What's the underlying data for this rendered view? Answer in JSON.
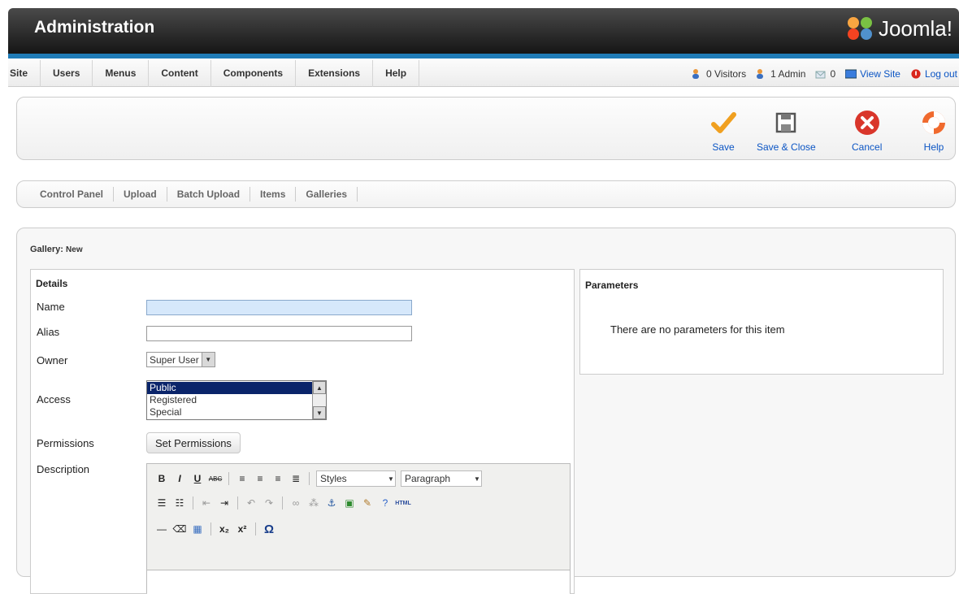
{
  "header": {
    "title": "Administration",
    "logo_text": "Joomla!"
  },
  "menu": [
    "Site",
    "Users",
    "Menus",
    "Content",
    "Components",
    "Extensions",
    "Help"
  ],
  "status": {
    "visitors": "0 Visitors",
    "admins": "1 Admin",
    "messages": "0",
    "view_site": "View Site",
    "logout": "Log out"
  },
  "toolbar": {
    "save": "Save",
    "save_close": "Save & Close",
    "cancel": "Cancel",
    "help": "Help"
  },
  "submenu": [
    "Control Panel",
    "Upload",
    "Batch Upload",
    "Items",
    "Galleries"
  ],
  "page": {
    "title_label": "Gallery:",
    "title_state": "New"
  },
  "details": {
    "heading": "Details",
    "name_label": "Name",
    "name_value": "",
    "alias_label": "Alias",
    "alias_value": "",
    "owner_label": "Owner",
    "owner_value": "Super User",
    "access_label": "Access",
    "access_options": [
      "Public",
      "Registered",
      "Special"
    ],
    "access_selected": "Public",
    "permissions_label": "Permissions",
    "permissions_button": "Set Permissions",
    "description_label": "Description"
  },
  "editor": {
    "styles": "Styles",
    "format": "Paragraph",
    "html_label": "HTML"
  },
  "parameters": {
    "heading": "Parameters",
    "empty_text": "There are no parameters for this item"
  },
  "colors": {
    "header_blue": "#1f7bb6",
    "link": "#0b55c4",
    "select_bg": "#0a246a",
    "focus_field": "#d6e8fb"
  }
}
